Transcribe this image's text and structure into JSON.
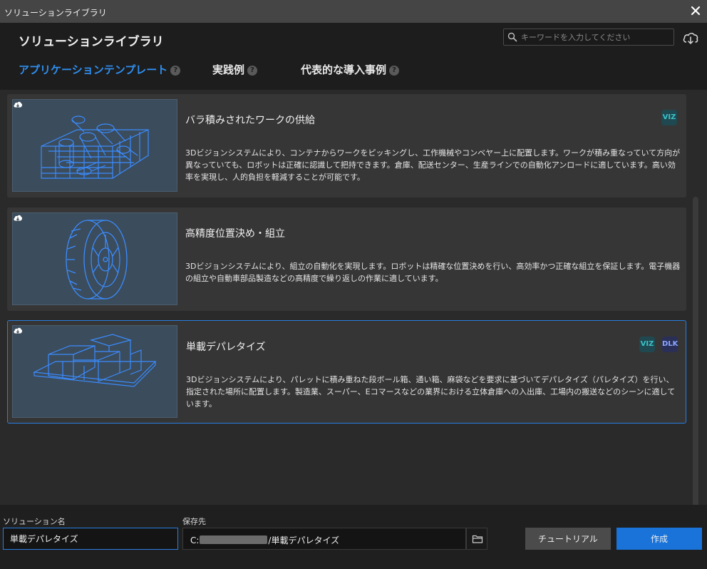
{
  "window": {
    "title": "ソリューションライブラリ"
  },
  "header": {
    "title": "ソリューションライブラリ",
    "search_placeholder": "キーワードを入力してください"
  },
  "tabs": [
    {
      "label": "アプリケーションテンプレート",
      "active": true
    },
    {
      "label": "実践例",
      "active": false
    },
    {
      "label": "代表的な導入事例",
      "active": false
    }
  ],
  "help_glyph": "?",
  "solutions": [
    {
      "title": "バラ積みされたワークの供給",
      "description": "3Dビジョンシステムにより、コンテナからワークをピッキングし、工作機械やコンベヤー上に配置します。ワークが積み重なっていて方向が異なっていても、ロボットは正確に認識して把持できます。倉庫、配送センター、生産ラインでの自動化アンロードに適しています。高い効率を実現し、人的負担を軽減することが可能です。",
      "badges": [
        "VIZ"
      ],
      "selected": false
    },
    {
      "title": "高精度位置決め・組立",
      "description": "3Dビジョンシステムにより、組立の自動化を実現します。ロボットは精確な位置決めを行い、高効率かつ正確な組立を保証します。電子機器の組立や自動車部品製造などの高精度で繰り返しの作業に適しています。",
      "badges": [],
      "selected": false
    },
    {
      "title": "単載デパレタイズ",
      "description": "3Dビジョンシステムにより、パレットに積み重ねた段ボール箱、通い箱、麻袋などを要求に基づいてデパレタイズ（パレタイズ）を行い、指定された場所に配置します。製造業、スーパー、Eコマースなどの業界における立体倉庫への入出庫、工場内の搬送などのシーンに適しています。",
      "badges": [
        "VIZ",
        "DLK"
      ],
      "selected": true
    }
  ],
  "footer": {
    "name_label": "ソリューション名",
    "name_value": "単載デパレタイズ",
    "path_label": "保存先",
    "path_prefix": "C:",
    "path_suffix": "/単載デパレタイズ",
    "tutorial_label": "チュートリアル",
    "create_label": "作成"
  },
  "colors": {
    "accent": "#2f8ff0",
    "selected_border": "#2a7ee0",
    "create_button": "#1a73d8"
  }
}
